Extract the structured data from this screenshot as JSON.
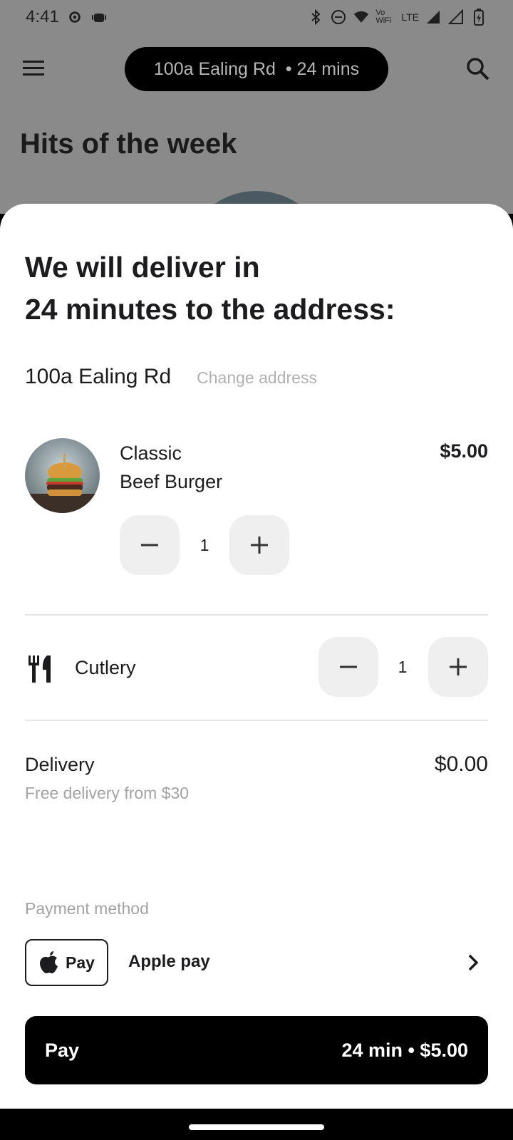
{
  "status_bar": {
    "time": "4:41",
    "icons_left": [
      "settings-icon",
      "android-icon"
    ],
    "icons_right": [
      "bluetooth-icon",
      "do-not-disturb-icon",
      "wifi-icon",
      "vowifi-label",
      "lte-label",
      "signal-icon",
      "signal-icon-2",
      "battery-icon"
    ],
    "vowifi": "Vo WiFi",
    "lte": "LTE"
  },
  "header": {
    "address": "100a Ealing Rd",
    "eta": "• 24 mins"
  },
  "background": {
    "section_title": "Hits of the week"
  },
  "sheet": {
    "title_line1": "We will deliver in",
    "title_line2": "24 minutes to the address:",
    "address": "100a Ealing Rd",
    "change_address": "Change address",
    "item": {
      "name_line1": "Classic",
      "name_line2": "Beef Burger",
      "price": "$5.00",
      "quantity": "1"
    },
    "cutlery": {
      "label": "Cutlery",
      "quantity": "1"
    },
    "delivery": {
      "label": "Delivery",
      "note": "Free delivery from $30",
      "price": "$0.00"
    },
    "payment": {
      "section_label": "Payment method",
      "badge_text": "Pay",
      "method_name": "Apple pay"
    },
    "pay_button": {
      "label": "Pay",
      "summary": "24 min • $5.00"
    }
  },
  "colors": {
    "accent": "#000000",
    "stepper_bg": "#efefef",
    "muted_text": "#a3a3a3",
    "overlay": "#8a8a8a"
  }
}
